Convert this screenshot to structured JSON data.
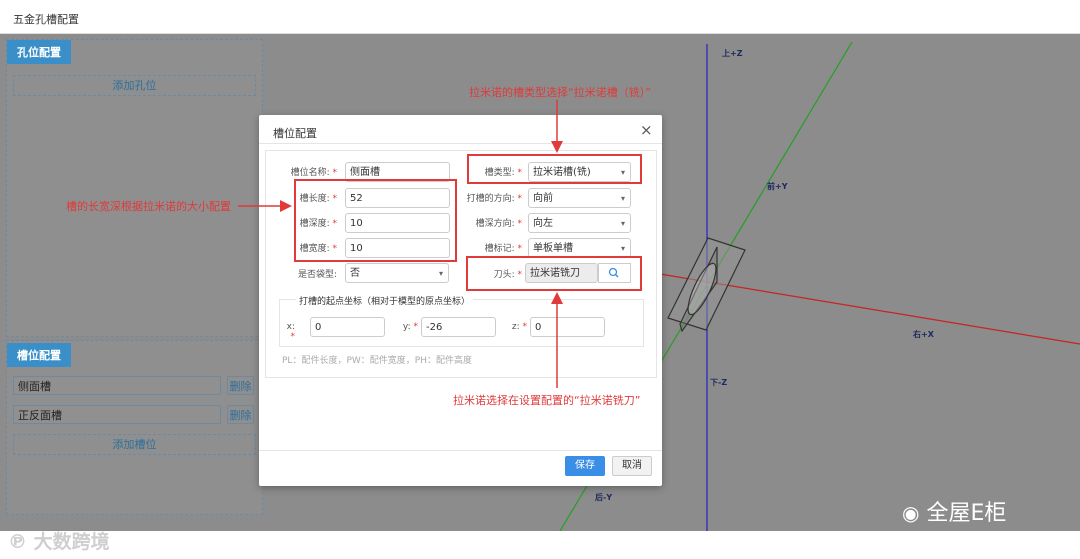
{
  "app": {
    "title": "五金孔槽配置"
  },
  "hole_panel": {
    "tab": "孔位配置",
    "add_button": "添加孔位"
  },
  "slot_panel": {
    "tab": "槽位配置",
    "rows": [
      {
        "name": "侧面槽",
        "delete": "删除"
      },
      {
        "name": "正反面槽",
        "delete": "删除"
      }
    ],
    "add_button": "添加槽位"
  },
  "modal": {
    "title": "槽位配置",
    "close_icon": "close-icon",
    "fields": {
      "slot_name": {
        "label": "槽位名称:",
        "value": "侧面槽"
      },
      "length": {
        "label": "槽长度:",
        "value": "52"
      },
      "depth": {
        "label": "槽深度:",
        "value": "10"
      },
      "width": {
        "label": "槽宽度:",
        "value": "10"
      },
      "is_pocket": {
        "label": "是否袋型:",
        "value": "否"
      },
      "slot_type": {
        "label": "槽类型:",
        "value": "拉米诺槽(铣)"
      },
      "direction": {
        "label": "打槽的方向:",
        "value": "向前"
      },
      "depth_direction": {
        "label": "槽深方向:",
        "value": "向左"
      },
      "mark": {
        "label": "槽标记:",
        "value": "单板单槽"
      },
      "tool": {
        "label": "刀头:",
        "value": "拉米诺铣刀",
        "icon": "search-icon"
      }
    },
    "coords": {
      "legend": "打槽的起点坐标（相对于模型的原点坐标）",
      "x": {
        "label": "x:",
        "value": "0"
      },
      "y": {
        "label": "y:",
        "value": "-26"
      },
      "z": {
        "label": "z:",
        "value": "0"
      }
    },
    "hint": "PL：配件长度，PW：配件宽度，PH：配件高度",
    "save": "保存",
    "cancel": "取消"
  },
  "annotations": {
    "slot_type_note": "拉米诺的槽类型选择“拉米诺槽（铣）”",
    "size_note": "槽的长宽深根据拉米诺的大小配置",
    "tool_note": "拉米诺选择在设置配置的“拉米诺铣刀”",
    "color": "#e03a3a"
  },
  "viewport": {
    "axes": {
      "up": "上+Z",
      "down": "下-Z",
      "front": "前+Y",
      "back": "后-Y",
      "right": "右+X"
    },
    "colors": {
      "z": "#2323c8",
      "y": "#22a022",
      "x": "#c82323"
    }
  },
  "watermark": {
    "left": "大数跨境",
    "right": "全屋E柜"
  }
}
